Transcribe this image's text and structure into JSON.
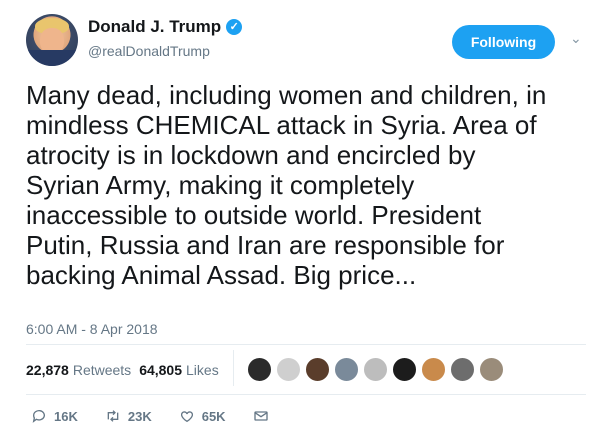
{
  "author": {
    "display_name": "Donald J. Trump",
    "handle": "@realDonaldTrump",
    "verified": true,
    "verified_icon": "verified-badge-icon"
  },
  "follow_button": {
    "label": "Following",
    "color": "#1da1f2"
  },
  "menu_icon": "chevron-down-icon",
  "tweet": {
    "lines": [
      "Many dead, including women and children, in",
      "mindless CHEMICAL attack in Syria. Area of",
      "atrocity is in lockdown and encircled by",
      "Syrian Army, making it completely",
      "inaccessible to outside world. President",
      "Putin, Russia and Iran are responsible for",
      "backing Animal Assad. Big price..."
    ],
    "timestamp": "6:00 AM - 8 Apr 2018"
  },
  "stats": {
    "retweets_count": "22,878",
    "retweets_label": "Retweets",
    "likes_count": "64,805",
    "likes_label": "Likes"
  },
  "likers": [
    "#2b2b2b",
    "#cfcfcf",
    "#5a3d2b",
    "#7a8a9a",
    "#bdbdbd",
    "#1c1c1c",
    "#c98a4b",
    "#6d6d6d",
    "#9a8c7a"
  ],
  "actions": [
    {
      "name": "reply",
      "icon": "reply-icon",
      "count": "16K"
    },
    {
      "name": "retweet",
      "icon": "retweet-icon",
      "count": "23K"
    },
    {
      "name": "like",
      "icon": "heart-icon",
      "count": "65K"
    },
    {
      "name": "message",
      "icon": "envelope-icon",
      "count": ""
    }
  ],
  "colors": {
    "text": "#14171a",
    "muted": "#657786",
    "accent": "#1da1f2",
    "border": "#e6ecf0"
  }
}
